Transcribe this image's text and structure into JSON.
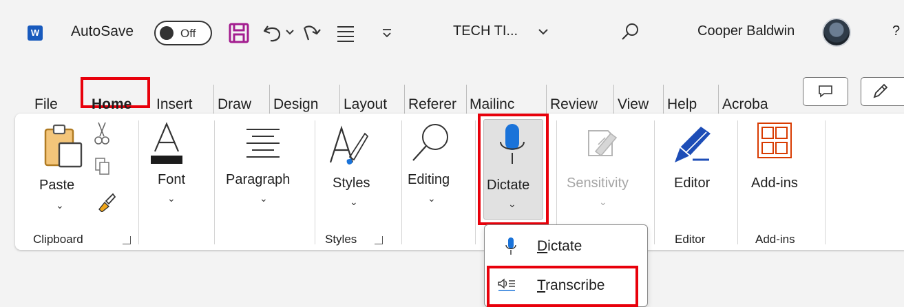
{
  "titlebar": {
    "autosave_label": "AutoSave",
    "autosave_state": "Off",
    "doc_title": "TECH TI...",
    "user_name": "Cooper Baldwin",
    "app_icon_letter": "W",
    "trailing": "?"
  },
  "tabs": [
    "File",
    "Home",
    "Insert",
    "Draw",
    "Design",
    "Layout",
    "Referer",
    "Mailinc",
    "Review",
    "View",
    "Help",
    "Acroba"
  ],
  "ribbon": {
    "paste": "Paste",
    "clipboard_group": "Clipboard",
    "font": "Font",
    "paragraph": "Paragraph",
    "styles": "Styles",
    "styles_group": "Styles",
    "editing": "Editing",
    "dictate": "Dictate",
    "sensitivity": "Sensitivity",
    "editor": "Editor",
    "editor_group": "Editor",
    "addins": "Add-ins",
    "addins_group": "Add-ins"
  },
  "dropdown": {
    "dictate_first": "D",
    "dictate_rest": "ictate",
    "transcribe_first": "T",
    "transcribe_rest": "ranscribe"
  },
  "colors": {
    "highlight": "#e8000b",
    "word_blue": "#185abd",
    "mic_blue": "#1a73d9",
    "addins_red": "#d83b01",
    "save_purple": "#a31d8f"
  }
}
